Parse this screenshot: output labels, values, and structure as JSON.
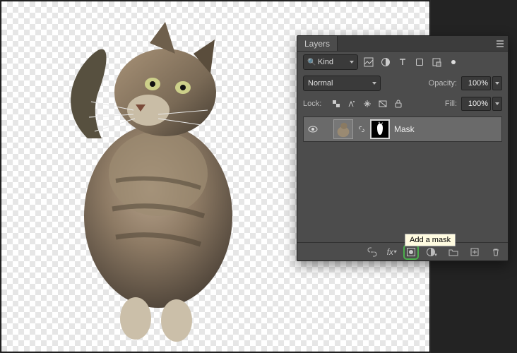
{
  "panel": {
    "title": "Layers",
    "filter": {
      "kind": "Kind"
    },
    "blend_mode": "Normal",
    "opacity_label": "Opacity:",
    "opacity_value": "100%",
    "lock_label": "Lock:",
    "fill_label": "Fill:",
    "fill_value": "100%",
    "layers": [
      {
        "name": "Mask",
        "visible": true
      }
    ],
    "tooltip": "Add a mask",
    "footer_icons": [
      "link",
      "fx",
      "add-mask",
      "adjustment",
      "group",
      "new-layer",
      "trash"
    ],
    "filter_icons": [
      "image",
      "adjustment",
      "type",
      "shape",
      "smart-object",
      "artboard"
    ],
    "lock_icons": [
      "transparency",
      "brush",
      "move",
      "artboard",
      "all"
    ]
  }
}
